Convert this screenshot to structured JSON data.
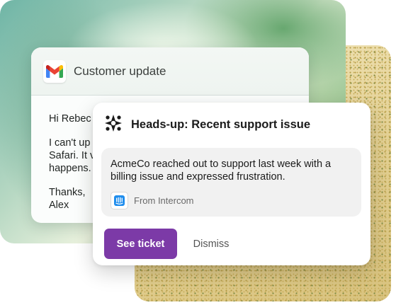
{
  "email": {
    "subject": "Customer update",
    "body_lines": [
      "Hi Rebec",
      "I can't up",
      "Safari. It v",
      "happens.",
      "Thanks,",
      "Alex"
    ],
    "app_icon": "gmail-icon"
  },
  "notification": {
    "app_icon": "assistant-logo-icon",
    "title": "Heads-up: Recent support issue",
    "message": "AcmeCo reached out to support last week with a billing issue and expressed frustration.",
    "source": {
      "icon": "intercom-icon",
      "label": "From Intercom"
    },
    "actions": {
      "primary_label": "See ticket",
      "secondary_label": "Dismiss"
    }
  },
  "colors": {
    "primary_button": "#7c3aa7",
    "gmail_red": "#ea4335",
    "gmail_blue": "#4285f4",
    "gmail_green": "#34a853",
    "gmail_yellow": "#fbbc04",
    "intercom_blue": "#1f8ded"
  }
}
